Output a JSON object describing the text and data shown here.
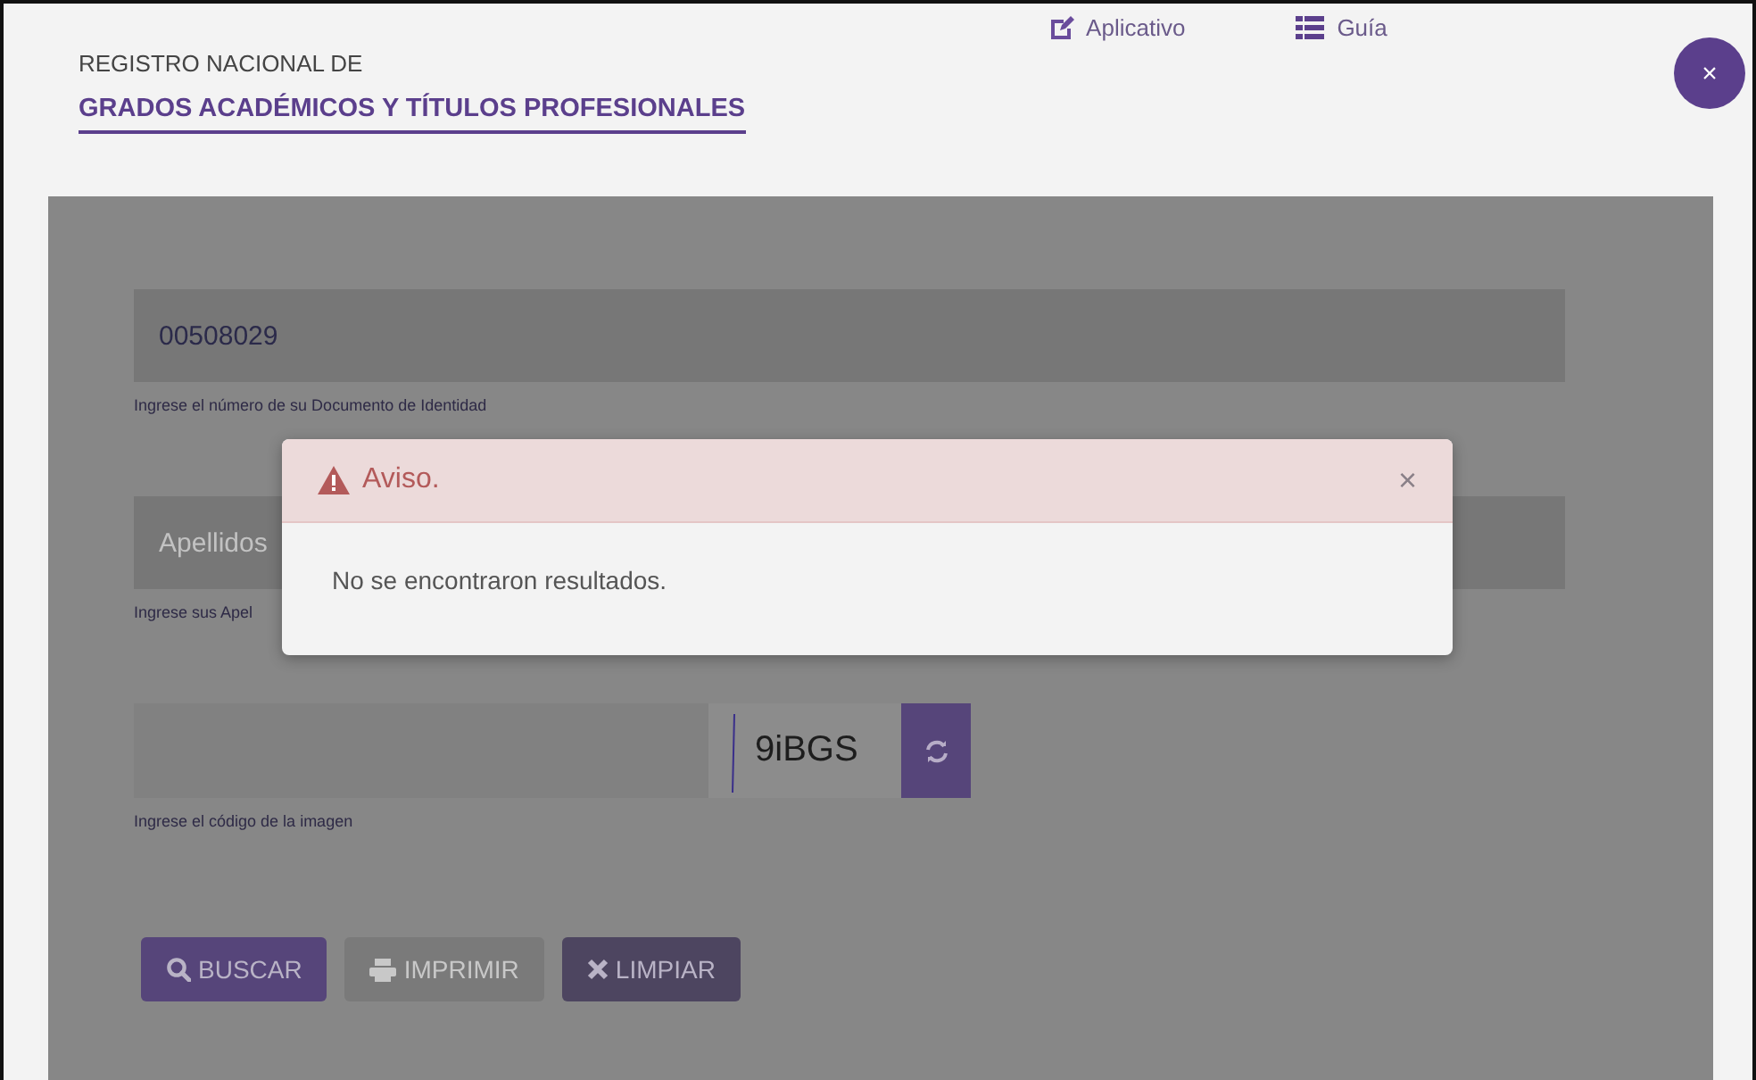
{
  "header": {
    "subtitle": "REGISTRO NACIONAL DE",
    "title": "GRADOS ACADÉMICOS Y TÍTULOS PROFESIONALES",
    "links": [
      {
        "label": "Aplicativo"
      },
      {
        "label": "Guía"
      }
    ],
    "close_label": "×"
  },
  "form": {
    "fields": [
      {
        "kind": "text",
        "value": "00508029",
        "hint": "Ingrese el número de su Documento de Identidad"
      },
      {
        "kind": "text",
        "placeholder": "Apellidos",
        "hint": "Ingrese sus Apel"
      },
      {
        "kind": "captcha",
        "captcha_code": "9iBGS",
        "hint": "Ingrese el código de la imagen"
      }
    ],
    "buttons": [
      {
        "label": "BUSCAR",
        "kind": "primary",
        "disabled": false
      },
      {
        "label": "IMPRIMIR",
        "kind": "primary",
        "disabled": true
      },
      {
        "label": "LIMPIAR",
        "kind": "dark",
        "disabled": false
      }
    ]
  },
  "modal": {
    "title": "Aviso.",
    "message": "No se encontraron resultados.",
    "close_label": "×"
  }
}
